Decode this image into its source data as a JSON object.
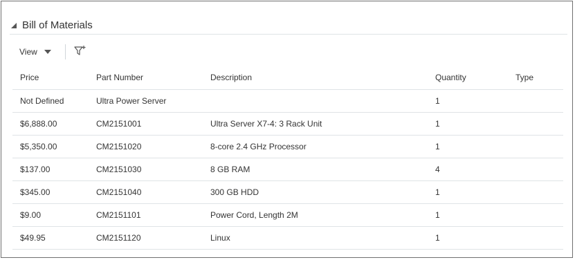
{
  "panel": {
    "title": "Bill of Materials"
  },
  "toolbar": {
    "view_label": "View",
    "view_icon": "chevron-down-icon",
    "filter_icon": "filter-add-icon"
  },
  "table": {
    "columns": [
      "Price",
      "Part Number",
      "Description",
      "Quantity",
      "Type"
    ],
    "rows": [
      {
        "price": "Not Defined",
        "part": "Ultra Power Server",
        "desc": "",
        "qty": "1",
        "type": ""
      },
      {
        "price": "$6,888.00",
        "part": "CM2151001",
        "desc": "Ultra Server X7-4: 3 Rack Unit",
        "qty": "1",
        "type": ""
      },
      {
        "price": "$5,350.00",
        "part": "CM2151020",
        "desc": "8-core 2.4 GHz Processor",
        "qty": "1",
        "type": ""
      },
      {
        "price": "$137.00",
        "part": "CM2151030",
        "desc": "8 GB RAM",
        "qty": "4",
        "type": ""
      },
      {
        "price": "$345.00",
        "part": "CM2151040",
        "desc": "300 GB HDD",
        "qty": "1",
        "type": ""
      },
      {
        "price": "$9.00",
        "part": "CM2151101",
        "desc": "Power Cord, Length 2M",
        "qty": "1",
        "type": ""
      },
      {
        "price": "$49.95",
        "part": "CM2151120",
        "desc": "Linux",
        "qty": "1",
        "type": ""
      }
    ]
  }
}
